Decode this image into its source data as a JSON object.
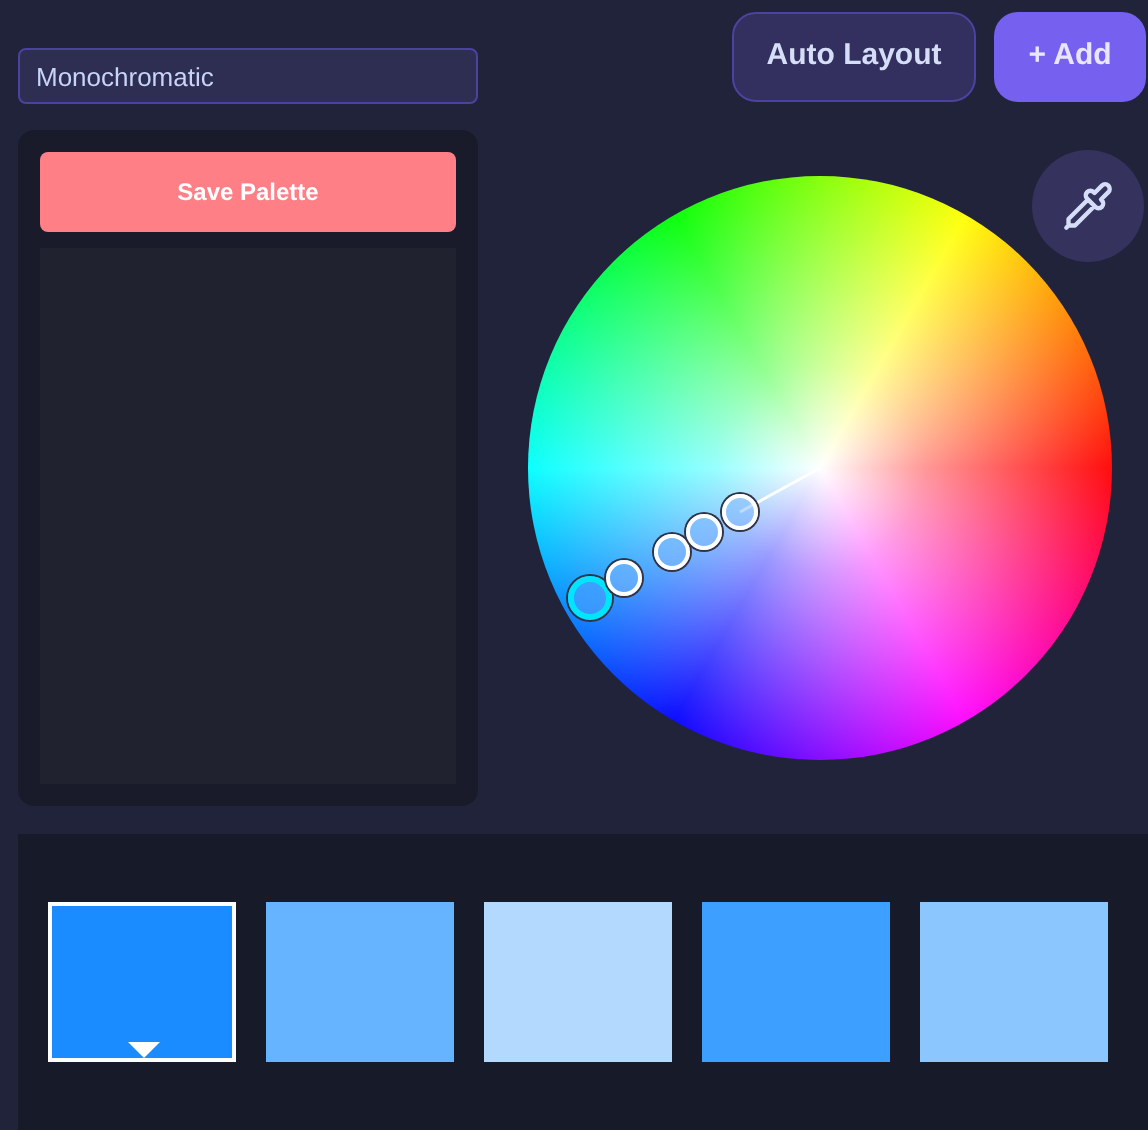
{
  "scheme_field": {
    "value": "Monochromatic"
  },
  "buttons": {
    "save": "Save Palette",
    "auto_layout": "Auto Layout",
    "add": "+ Add"
  },
  "swatches": [
    {
      "color": "#1a8cff",
      "selected": true
    },
    {
      "color": "#66b3ff",
      "selected": false
    },
    {
      "color": "#b3d9ff",
      "selected": false
    },
    {
      "color": "#3d9fff",
      "selected": false
    },
    {
      "color": "#8cc6ff",
      "selected": false
    }
  ]
}
